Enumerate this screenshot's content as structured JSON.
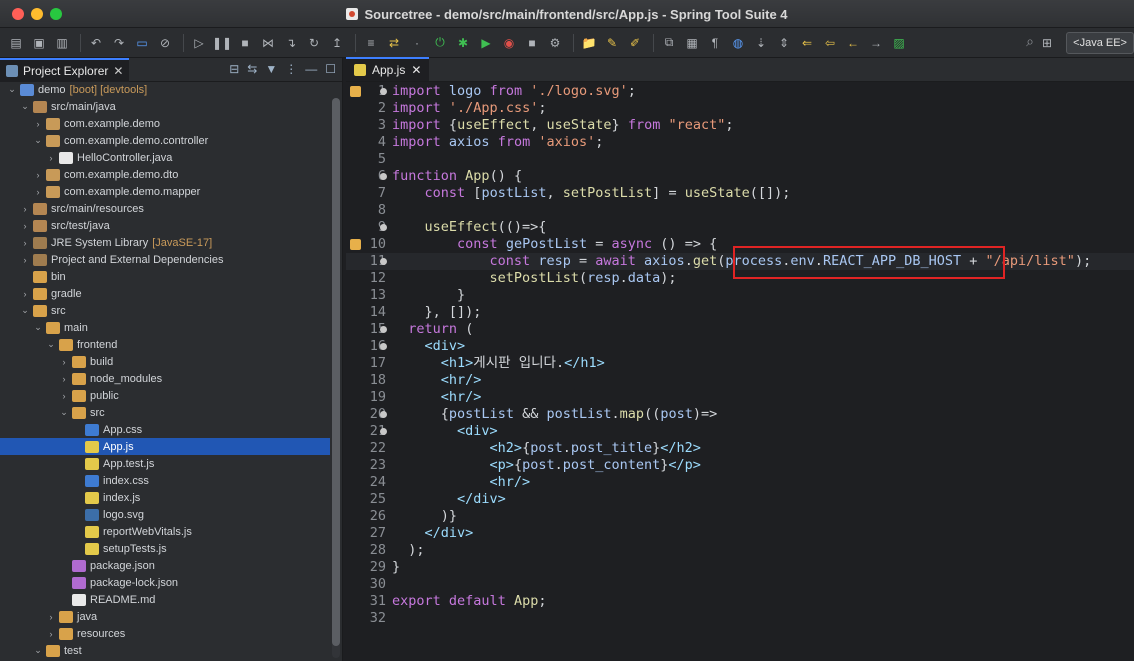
{
  "window": {
    "title": "Sourcetree - demo/src/main/frontend/src/App.js - Spring Tool Suite 4"
  },
  "toolbar": {
    "perspective": "<Java EE>"
  },
  "explorer": {
    "tab_label": "Project Explorer",
    "items": [
      {
        "label": "demo",
        "deco": "[boot] [devtools]",
        "indent": 0,
        "arrow": "down",
        "icon": "project"
      },
      {
        "label": "src/main/java",
        "indent": 1,
        "arrow": "down",
        "icon": "src"
      },
      {
        "label": "com.example.demo",
        "indent": 2,
        "arrow": "right",
        "icon": "pkg"
      },
      {
        "label": "com.example.demo.controller",
        "indent": 2,
        "arrow": "down",
        "icon": "pkg"
      },
      {
        "label": "HelloController.java",
        "indent": 3,
        "arrow": "right",
        "icon": "java"
      },
      {
        "label": "com.example.demo.dto",
        "indent": 2,
        "arrow": "right",
        "icon": "pkg"
      },
      {
        "label": "com.example.demo.mapper",
        "indent": 2,
        "arrow": "right",
        "icon": "pkg"
      },
      {
        "label": "src/main/resources",
        "indent": 1,
        "arrow": "right",
        "icon": "src"
      },
      {
        "label": "src/test/java",
        "indent": 1,
        "arrow": "right",
        "icon": "src"
      },
      {
        "label": "JRE System Library",
        "deco": "[JavaSE-17]",
        "indent": 1,
        "arrow": "right",
        "icon": "lib"
      },
      {
        "label": "Project and External Dependencies",
        "indent": 1,
        "arrow": "right",
        "icon": "lib"
      },
      {
        "label": "bin",
        "indent": 1,
        "arrow": "",
        "icon": "folder"
      },
      {
        "label": "gradle",
        "indent": 1,
        "arrow": "right",
        "icon": "folder"
      },
      {
        "label": "src",
        "indent": 1,
        "arrow": "down",
        "icon": "folder"
      },
      {
        "label": "main",
        "indent": 2,
        "arrow": "down",
        "icon": "folder"
      },
      {
        "label": "frontend",
        "indent": 3,
        "arrow": "down",
        "icon": "folder"
      },
      {
        "label": "build",
        "indent": 4,
        "arrow": "right",
        "icon": "folder"
      },
      {
        "label": "node_modules",
        "indent": 4,
        "arrow": "right",
        "icon": "folder"
      },
      {
        "label": "public",
        "indent": 4,
        "arrow": "right",
        "icon": "folder"
      },
      {
        "label": "src",
        "indent": 4,
        "arrow": "down",
        "icon": "folder"
      },
      {
        "label": "App.css",
        "indent": 5,
        "arrow": "",
        "icon": "css"
      },
      {
        "label": "App.js",
        "indent": 5,
        "arrow": "",
        "icon": "js",
        "selected": true
      },
      {
        "label": "App.test.js",
        "indent": 5,
        "arrow": "",
        "icon": "js"
      },
      {
        "label": "index.css",
        "indent": 5,
        "arrow": "",
        "icon": "css"
      },
      {
        "label": "index.js",
        "indent": 5,
        "arrow": "",
        "icon": "js"
      },
      {
        "label": "logo.svg",
        "indent": 5,
        "arrow": "",
        "icon": "svg"
      },
      {
        "label": "reportWebVitals.js",
        "indent": 5,
        "arrow": "",
        "icon": "js"
      },
      {
        "label": "setupTests.js",
        "indent": 5,
        "arrow": "",
        "icon": "js"
      },
      {
        "label": "package.json",
        "indent": 4,
        "arrow": "",
        "icon": "json"
      },
      {
        "label": "package-lock.json",
        "indent": 4,
        "arrow": "",
        "icon": "json"
      },
      {
        "label": "README.md",
        "indent": 4,
        "arrow": "",
        "icon": "md"
      },
      {
        "label": "java",
        "indent": 3,
        "arrow": "right",
        "icon": "folder"
      },
      {
        "label": "resources",
        "indent": 3,
        "arrow": "right",
        "icon": "folder"
      },
      {
        "label": "test",
        "indent": 2,
        "arrow": "down",
        "icon": "folder"
      }
    ]
  },
  "editor": {
    "tab_label": "App.js",
    "lines": [
      "import logo from './logo.svg';",
      "import './App.css';",
      "import {useEffect, useState} from \"react\";",
      "import axios from 'axios';",
      "",
      "function App() {",
      "    const [postList, setPostList] = useState([]);",
      "",
      "    useEffect(()=>{",
      "        const gePostList = async () => {",
      "            const resp = await axios.get(process.env.REACT_APP_DB_HOST + \"/api/list\");",
      "            setPostList(resp.data);",
      "        }",
      "    }, []);",
      "  return (",
      "    <div>",
      "      <h1>게시판 입니다.</h1>",
      "      <hr/>",
      "      <hr/>",
      "      {postList && postList.map((post)=>",
      "        <div>",
      "            <h2>{post.post_title}</h2>",
      "            <p>{post.post_content}</p>",
      "            <hr/>",
      "        </div>",
      "      )}",
      "    </div>",
      "  );",
      "}",
      "",
      "export default App;",
      ""
    ],
    "fold_lines": [
      1,
      6,
      9,
      11,
      15,
      16,
      20,
      21
    ],
    "warning_lines": [
      1,
      10
    ],
    "current_line": 11,
    "highlight_text": "process.env.REACT_APP_DB_HOST +"
  },
  "colors": {
    "accent": "#3d7fff",
    "selection": "#2157b4",
    "highlight_box": "#e02424"
  }
}
